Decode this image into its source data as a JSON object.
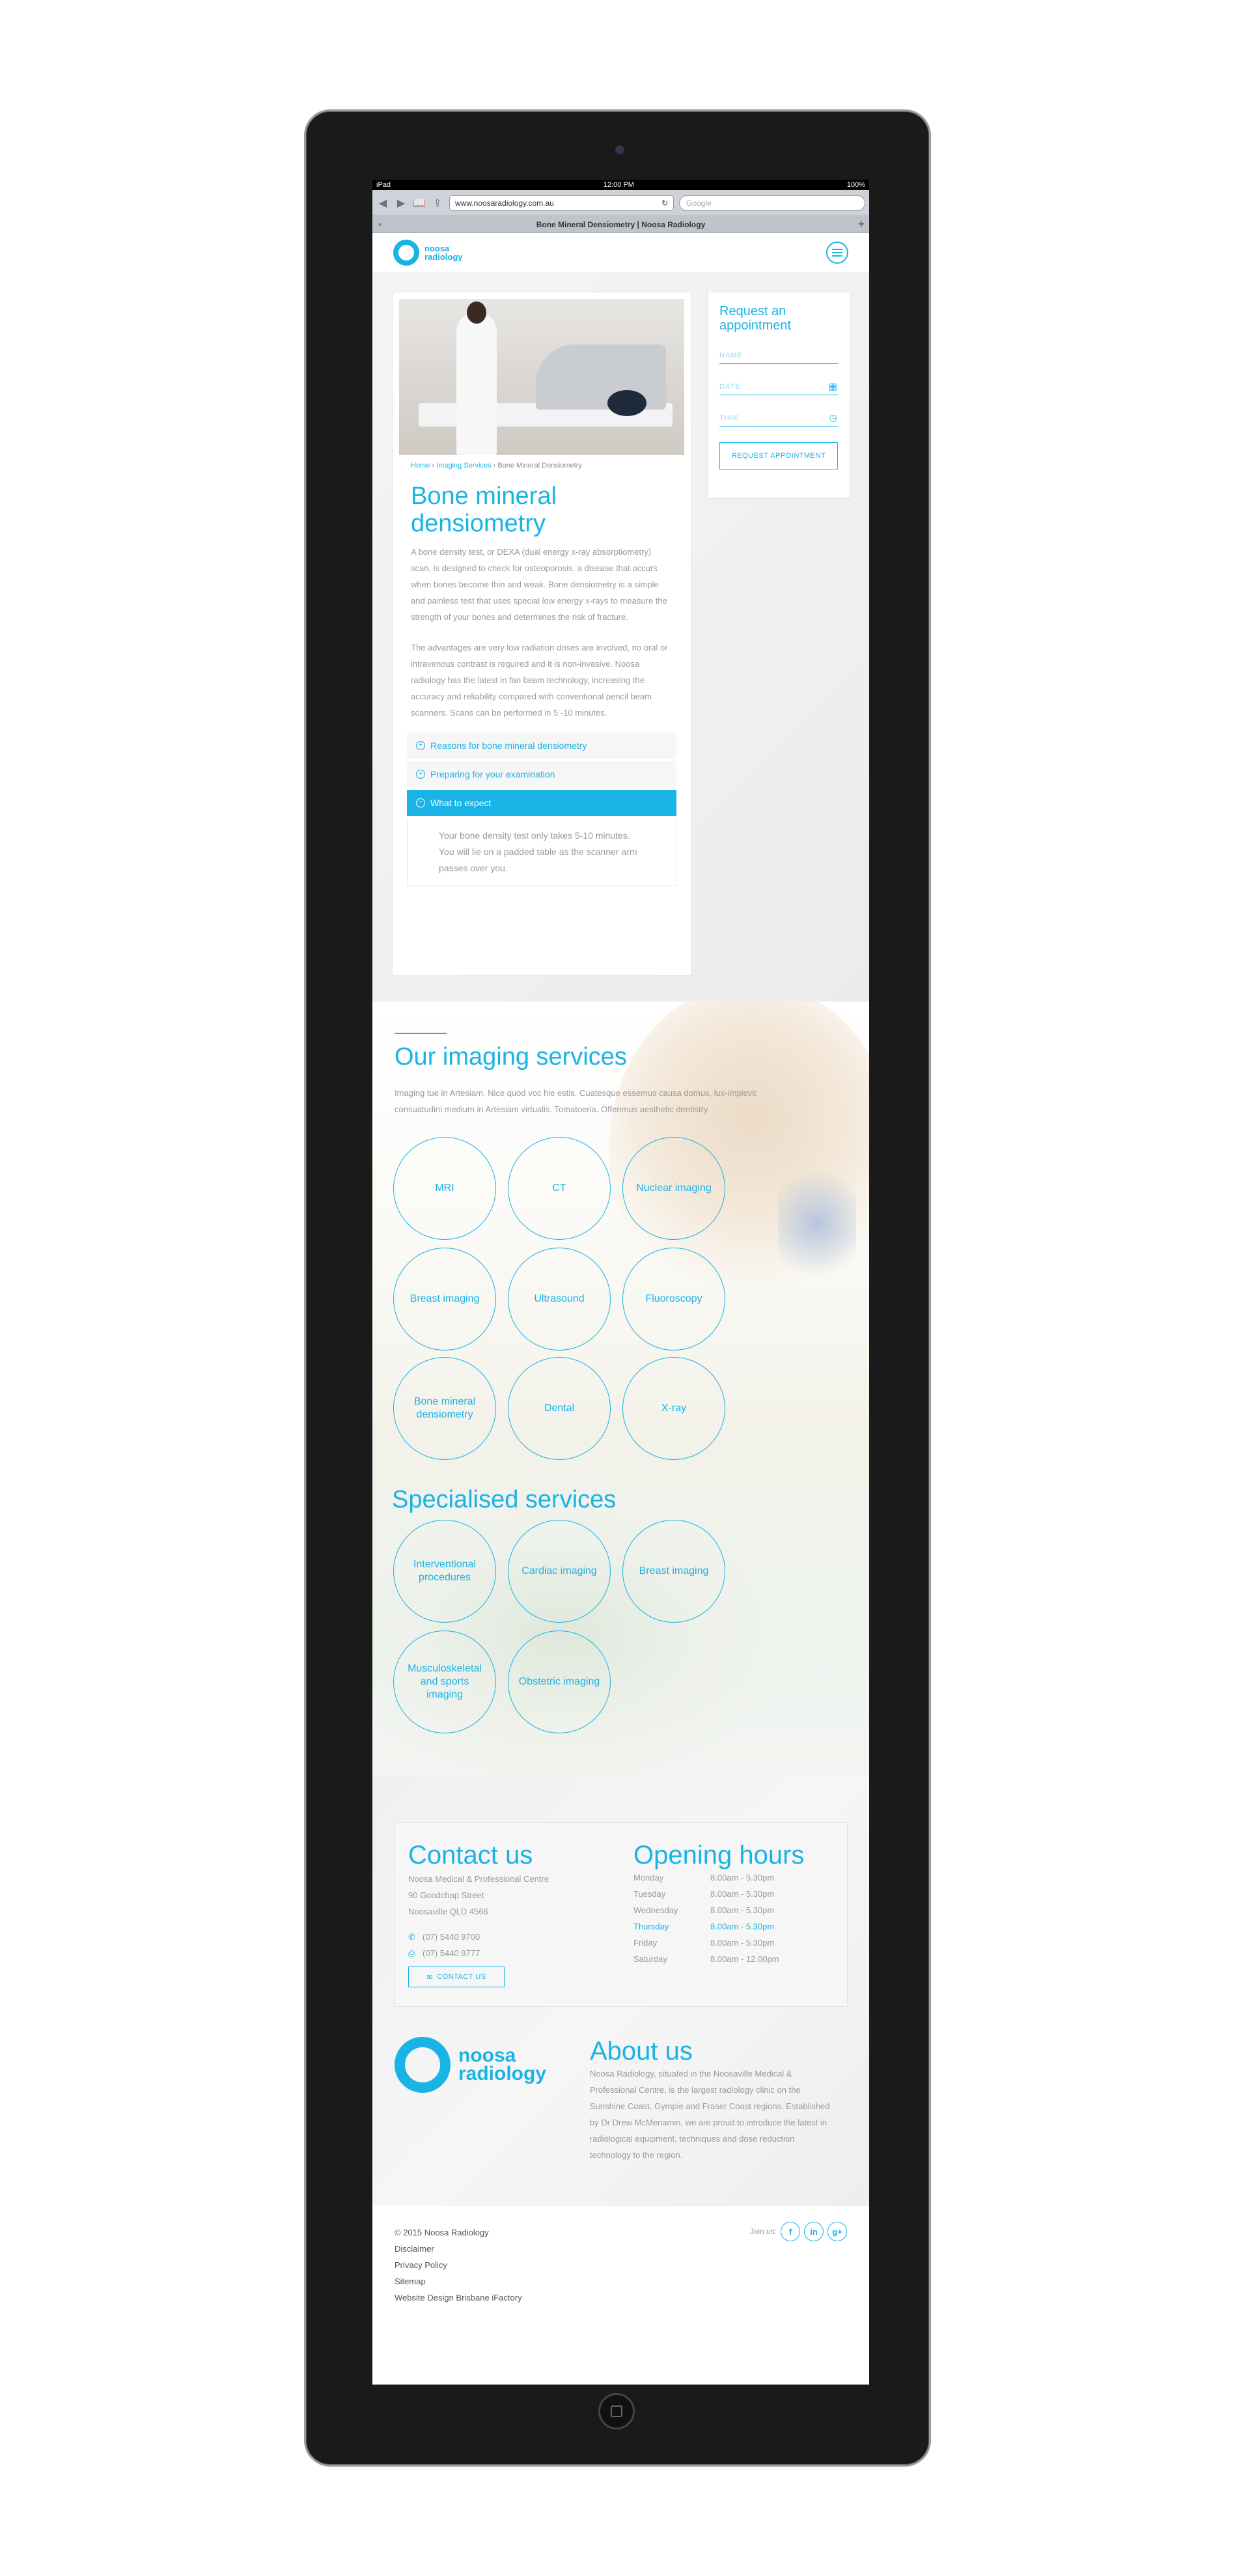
{
  "status": {
    "device": "iPad",
    "time": "12:00 PM",
    "battery": "100%"
  },
  "browser": {
    "url": "www.noosaradiology.com.au",
    "search_placeholder": "Google",
    "tab_title": "Bone Mineral Densiometry | Noosa Radiology"
  },
  "logo": {
    "line1": "noosa",
    "line2": "radiology"
  },
  "hero": {
    "breadcrumb": {
      "home": "Home",
      "sep": "›",
      "section": "Imaging Services",
      "current": "Bone Mineral Densiometry"
    },
    "title": "Bone mineral densiometry",
    "para1": "A bone density test, or DEXA (dual energy x-ray absorptiometry) scan, is designed to check for osteoporosis, a disease that occurs when bones become thin and weak. Bone densiometry is a simple and painless test that uses special low energy x-rays to measure the strength of your bones and determines the risk of fracture.",
    "para2": "The advantages are very low radiation doses are involved, no oral or intravenous contrast is required and it is non-invasive. Noosa radiology has the latest in fan beam technology, increasing the accuracy and reliability compared with conventional pencil beam scanners. Scans can be performed in 5 -10 minutes.",
    "accordion": [
      {
        "label": "Reasons for bone mineral densiometry"
      },
      {
        "label": "Preparing for your examination"
      },
      {
        "label": "What to expect"
      }
    ],
    "accordion_body": "Your bone density test only takes 5-10 minutes. You will lie on a padded table as the scanner arm passes over you."
  },
  "appointment": {
    "title": "Request an appointment",
    "name": "NAME",
    "date": "DATE",
    "time": "TIME",
    "button": "REQUEST APPOINTMENT"
  },
  "services": {
    "title": "Our imaging services",
    "intro": "Imaging tue in Artesiam. Nice quod voc hie estis. Cuatesque essemus causa domus, lux-implevit consuatudini medium in Artesiam virtualis. Tomatoeria. Offerimus aesthetic dentistry.",
    "items": [
      "MRI",
      "CT",
      "Nuclear imaging",
      "Breast imaging",
      "Ultrasound",
      "Fluoroscopy",
      "Bone mineral densiometry",
      "Dental",
      "X-ray"
    ],
    "special_title": "Specialised services",
    "special_items": [
      "Interventional procedures",
      "Cardiac imaging",
      "Breast imaging",
      "Musculoskeletal and sports imaging",
      "Obstetric imaging"
    ]
  },
  "contact": {
    "title": "Contact us",
    "address": [
      "Noosa Medical & Professional Centre",
      "90 Goodchap Street",
      "Noosaville QLD 4566"
    ],
    "phone": "(07) 5440 9700",
    "fax": "(07) 5440 9777",
    "button": "CONTACT US"
  },
  "hours": {
    "title": "Opening hours",
    "rows": [
      {
        "day": "Monday",
        "time": "8.00am  -  5.30pm"
      },
      {
        "day": "Tuesday",
        "time": "8.00am  -  5.30pm"
      },
      {
        "day": "Wednesday",
        "time": "8.00am  -  5.30pm"
      },
      {
        "day": "Thursday",
        "time": "8.00am  -  5.30pm"
      },
      {
        "day": "Friday",
        "time": "8.00am  -  5.30pm"
      },
      {
        "day": "Saturday",
        "time": "8.00am  -  12.00pm"
      }
    ]
  },
  "about": {
    "title": "About us",
    "text": "Noosa Radiology, situated in the Noosaville Medical & Professional Centre, is the largest radiology clinic on the Sunshine Coast, Gympie and Fraser Coast regions. Established by Dr Drew McMenamin, we are proud to introduce the latest in radiological equipment, techniques and dose reduction technology to the region."
  },
  "footer": {
    "links": [
      "© 2015 Noosa Radiology",
      "Disclaimer",
      "Privacy Policy",
      "Sitemap",
      "Website Design Brisbane iFactory"
    ],
    "join_label": "Join us:",
    "social": [
      "f",
      "in",
      "g+"
    ]
  }
}
